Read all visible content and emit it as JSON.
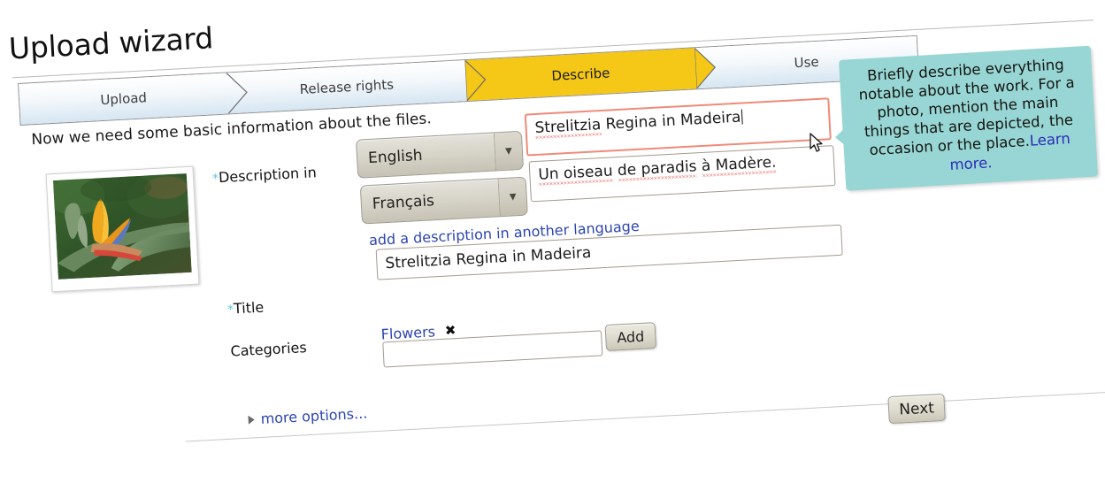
{
  "page": {
    "title": "Upload wizard",
    "intro": "Now we need some basic information about the files."
  },
  "steps": [
    {
      "label": "Upload",
      "state": "done"
    },
    {
      "label": "Release rights",
      "state": "done"
    },
    {
      "label": "Describe",
      "state": "active"
    },
    {
      "label": "Use",
      "state": "upcoming"
    }
  ],
  "thumbnail": {
    "alt": "Strelitzia bird of paradise flower"
  },
  "form": {
    "description": {
      "label": "Description in",
      "required_marker": "*",
      "rows": [
        {
          "language": "English",
          "value": "Strelitzia Regina in Madeira",
          "misspelled": [
            "Strelitzia"
          ],
          "focused": true
        },
        {
          "language": "Français",
          "value": "Un oiseau de paradis à Madère.",
          "misspelled": [
            "Un oiseau",
            "de paradis",
            "à Madère."
          ],
          "focused": false
        }
      ],
      "add_language_link": "add a description in another language"
    },
    "title": {
      "label": "Title",
      "required_marker": "*",
      "value": "Strelitzia Regina in Madeira",
      "placeholder": ""
    },
    "categories": {
      "label": "Categories",
      "tags": [
        {
          "name": "Flowers",
          "remove_glyph": "✖"
        }
      ],
      "input_value": "",
      "placeholder": "",
      "add_button": "Add"
    },
    "more_options": "more options..."
  },
  "tooltip": {
    "text": "Briefly describe everything notable about the work. For a photo, mention the main things that are depicted, the occasion or the place.",
    "link": "Learn more.",
    "bg_color": "#97d6d4"
  },
  "footer": {
    "next_button": "Next"
  },
  "colors": {
    "active_step": "#f5c716",
    "step_gradient_end": "#d6e6f2",
    "link": "#2b44b0",
    "required_star": "#63c8e6",
    "focus_border": "#f08a78",
    "spellcheck": "#e8392f"
  },
  "select_arrow_glyph": "▼"
}
